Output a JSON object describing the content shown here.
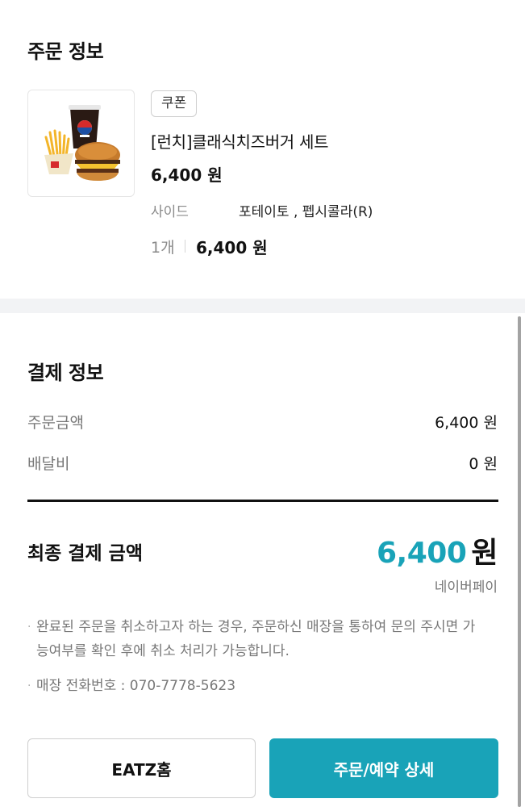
{
  "order_info": {
    "title": "주문 정보",
    "item": {
      "badge": "쿠폰",
      "name": "[런치]클래식치즈버거 세트",
      "price": "6,400 원",
      "option_label": "사이드",
      "option_value": "포테이토 , 펩시콜라(R)",
      "quantity": "1개",
      "total": "6,400 원",
      "image_icon": "burger-set-image"
    }
  },
  "payment_info": {
    "title": "결제 정보",
    "rows": [
      {
        "label": "주문금액",
        "value": "6,400 원"
      },
      {
        "label": "배달비",
        "value": "0 원"
      }
    ],
    "final_label": "최종 결제 금액",
    "final_amount": "6,400",
    "final_unit": "원",
    "method": "네이버페이"
  },
  "notices": [
    "완료된 주문을 취소하고자 하는 경우, 주문하신 매장을 통하여 문의 주시면 가능여부를 확인 후에 취소 처리가 가능합니다.",
    "매장 전화번호 : 070-7778-5623"
  ],
  "buttons": {
    "home": "EATZ홈",
    "detail": "주문/예약 상세"
  },
  "colors": {
    "accent": "#19a3b8",
    "divider": "#f2f3f5"
  }
}
